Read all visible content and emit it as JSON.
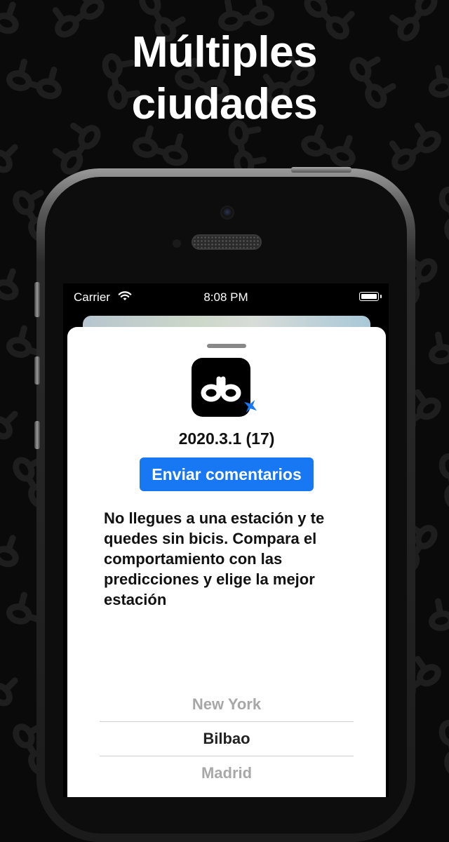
{
  "headline": {
    "line1": "Múltiples",
    "line2": "ciudades"
  },
  "status_bar": {
    "carrier": "Carrier",
    "time": "8:08 PM"
  },
  "app": {
    "icon": "db-logo-icon",
    "badge_icon": "airplane-icon",
    "version": "2020.3.1 (17)",
    "feedback_button": "Enviar comentarios",
    "description": "No llegues a una estación y te quedes sin bicis. Compara el comportamiento con las predicciones y elige la mejor estación"
  },
  "city_picker": {
    "options": [
      "New York",
      "Bilbao",
      "Madrid"
    ],
    "selected": "Bilbao"
  },
  "colors": {
    "accent": "#1877f2",
    "background": "#0a0a0a"
  }
}
